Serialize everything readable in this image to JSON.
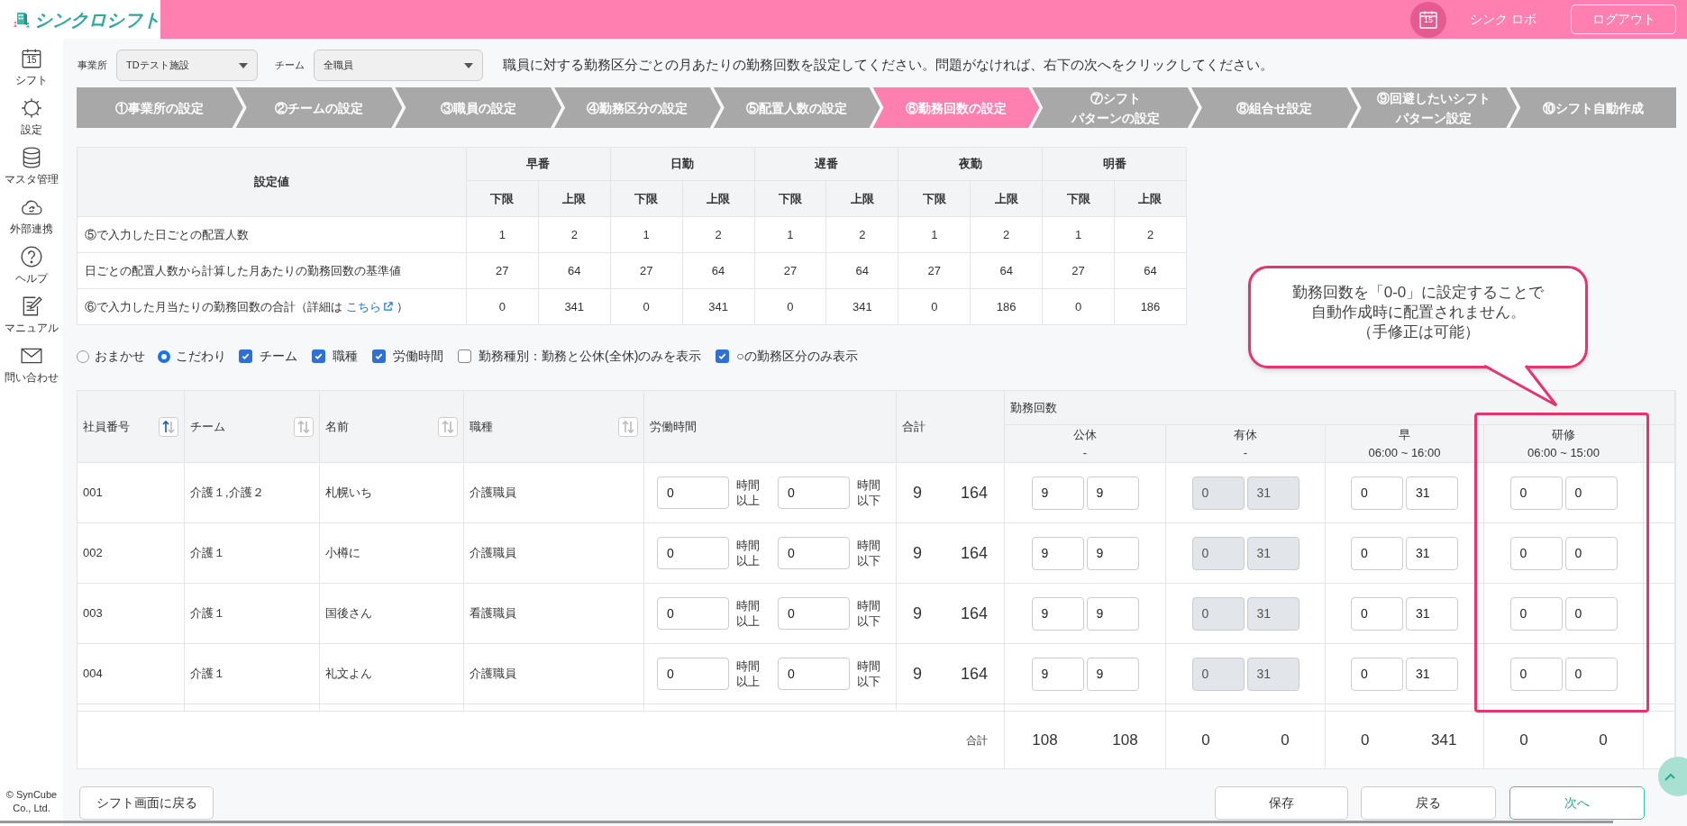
{
  "header": {
    "logo_text": "シンクロシフト",
    "calendar_date": "15",
    "user_name": "シンク ロボ",
    "logout": "ログアウト"
  },
  "sidebar": {
    "items": [
      {
        "kind": "calendar",
        "label": "シフト",
        "date": "15"
      },
      {
        "kind": "gear",
        "label": "設定"
      },
      {
        "kind": "database",
        "label": "マスタ管理"
      },
      {
        "kind": "cloud",
        "label": "外部連携"
      },
      {
        "kind": "help",
        "label": "ヘルプ"
      },
      {
        "kind": "manual",
        "label": "マニュアル"
      },
      {
        "kind": "mail",
        "label": "問い合わせ"
      }
    ],
    "copyright": "© SynCube Co., Ltd."
  },
  "filters": {
    "office_label": "事業所",
    "office_value": "TDテスト施設",
    "team_label": "チーム",
    "team_value": "全職員",
    "instruction": "職員に対する勤務区分ごとの月あたりの勤務回数を設定してください。問題がなければ、右下の次へをクリックしてください。"
  },
  "steps": [
    {
      "lines": [
        "①事業所の設定"
      ],
      "selected": false
    },
    {
      "lines": [
        "②チームの設定"
      ],
      "selected": false
    },
    {
      "lines": [
        "③職員の設定"
      ],
      "selected": false
    },
    {
      "lines": [
        "④勤務区分の設定"
      ],
      "selected": false
    },
    {
      "lines": [
        "⑤配置人数の設定"
      ],
      "selected": false
    },
    {
      "lines": [
        "⑥勤務回数の設定"
      ],
      "selected": true
    },
    {
      "lines": [
        "⑦シフト",
        "パターンの設定"
      ],
      "selected": false
    },
    {
      "lines": [
        "⑧組合せ設定"
      ],
      "selected": false
    },
    {
      "lines": [
        "⑨回避したいシフト",
        "パターン設定"
      ],
      "selected": false
    },
    {
      "lines": [
        "⑩シフト自動作成"
      ],
      "selected": false
    }
  ],
  "summary": {
    "corner": "設定値",
    "groups": [
      {
        "name": "早番",
        "sub": [
          "下限",
          "上限"
        ]
      },
      {
        "name": "日勤",
        "sub": [
          "下限",
          "上限"
        ]
      },
      {
        "name": "遅番",
        "sub": [
          "下限",
          "上限"
        ]
      },
      {
        "name": "夜勤",
        "sub": [
          "下限",
          "上限"
        ]
      },
      {
        "name": "明番",
        "sub": [
          "下限",
          "上限"
        ]
      }
    ],
    "rows": [
      {
        "label": "⑤で入力した日ごとの配置人数",
        "values": [
          "1",
          "2",
          "1",
          "2",
          "1",
          "2",
          "1",
          "2",
          "1",
          "2"
        ]
      },
      {
        "label": "日ごとの配置人数から計算した月あたりの勤務回数の基準値",
        "values": [
          "27",
          "64",
          "27",
          "64",
          "27",
          "64",
          "27",
          "64",
          "27",
          "64"
        ]
      },
      {
        "label": "⑥で入力した月当たりの勤務回数の合計（詳細は",
        "link": "こちら",
        "label_end": "）",
        "values": [
          "0",
          "341",
          "0",
          "341",
          "0",
          "341",
          "0",
          "186",
          "0",
          "186"
        ]
      }
    ]
  },
  "options": {
    "radios": [
      {
        "label": "おまかせ",
        "selected": false
      },
      {
        "label": "こだわり",
        "selected": true
      }
    ],
    "checkboxes": [
      {
        "label": "チーム",
        "checked": true
      },
      {
        "label": "職種",
        "checked": true
      },
      {
        "label": "労働時間",
        "checked": true
      },
      {
        "label": "勤務種別：勤務と公休(全休)のみを表示",
        "checked": false
      },
      {
        "label": "○の勤務区分のみ表示",
        "checked": true
      }
    ]
  },
  "table": {
    "columns": [
      {
        "label": "社員番号",
        "sorted": true
      },
      {
        "label": "チーム",
        "sorted": false
      },
      {
        "label": "名前",
        "sorted": false
      },
      {
        "label": "職種",
        "sorted": false
      },
      {
        "label": "労働時間"
      },
      {
        "label": "合計"
      }
    ],
    "group_label": "勤務回数",
    "shift_columns": [
      {
        "name": "公休",
        "time": "-",
        "highlighted": false
      },
      {
        "name": "有休",
        "time": "-",
        "highlighted": false
      },
      {
        "name": "早",
        "time": "06:00 ~ 16:00",
        "highlighted": false
      },
      {
        "name": "研修",
        "time": "06:00 ~ 15:00",
        "highlighted": true
      }
    ],
    "rows": [
      {
        "id": "001",
        "team": "介護１,介護２",
        "name": "札幌いち",
        "job": "介護職員",
        "hours": [
          {
            "value": "0",
            "unit": [
              "時間",
              "以上"
            ]
          },
          {
            "value": "0",
            "unit": [
              "時間",
              "以下"
            ]
          }
        ],
        "total": [
          "9",
          "164"
        ],
        "counts": [
          {
            "values": [
              "9",
              "9"
            ],
            "disabled": false
          },
          {
            "values": [
              "0",
              "31"
            ],
            "disabled": true
          },
          {
            "values": [
              "0",
              "31"
            ],
            "disabled": false
          },
          {
            "values": [
              "0",
              "0"
            ],
            "disabled": false
          }
        ]
      },
      {
        "id": "002",
        "team": "介護１",
        "name": "小樽に",
        "job": "介護職員",
        "hours": [
          {
            "value": "0",
            "unit": [
              "時間",
              "以上"
            ]
          },
          {
            "value": "0",
            "unit": [
              "時間",
              "以下"
            ]
          }
        ],
        "total": [
          "9",
          "164"
        ],
        "counts": [
          {
            "values": [
              "9",
              "9"
            ],
            "disabled": false
          },
          {
            "values": [
              "0",
              "31"
            ],
            "disabled": true
          },
          {
            "values": [
              "0",
              "31"
            ],
            "disabled": false
          },
          {
            "values": [
              "0",
              "0"
            ],
            "disabled": false
          }
        ]
      },
      {
        "id": "003",
        "team": "介護１",
        "name": "国後さん",
        "job": "看護職員",
        "hours": [
          {
            "value": "0",
            "unit": [
              "時間",
              "以上"
            ]
          },
          {
            "value": "0",
            "unit": [
              "時間",
              "以下"
            ]
          }
        ],
        "total": [
          "9",
          "164"
        ],
        "counts": [
          {
            "values": [
              "9",
              "9"
            ],
            "disabled": false
          },
          {
            "values": [
              "0",
              "31"
            ],
            "disabled": true
          },
          {
            "values": [
              "0",
              "31"
            ],
            "disabled": false
          },
          {
            "values": [
              "0",
              "0"
            ],
            "disabled": false
          }
        ]
      },
      {
        "id": "004",
        "team": "介護１",
        "name": "礼文よん",
        "job": "介護職員",
        "hours": [
          {
            "value": "0",
            "unit": [
              "時間",
              "以上"
            ]
          },
          {
            "value": "0",
            "unit": [
              "時間",
              "以下"
            ]
          }
        ],
        "total": [
          "9",
          "164"
        ],
        "counts": [
          {
            "values": [
              "9",
              "9"
            ],
            "disabled": false
          },
          {
            "values": [
              "0",
              "31"
            ],
            "disabled": true
          },
          {
            "values": [
              "0",
              "31"
            ],
            "disabled": false
          },
          {
            "values": [
              "0",
              "0"
            ],
            "disabled": false
          }
        ]
      }
    ],
    "totals": {
      "label": "合計",
      "values": [
        [
          "108",
          "108"
        ],
        [
          "0",
          "0"
        ],
        [
          "0",
          "341"
        ],
        [
          "0",
          "0"
        ]
      ]
    }
  },
  "callout": {
    "lines": [
      "勤務回数を「0-0」に設定することで",
      "自動作成時に配置されません。",
      "（手修正は可能）"
    ]
  },
  "footer": {
    "back_to_shift": "シフト画面に戻る",
    "save": "保存",
    "back": "戻る",
    "next": "次へ"
  }
}
